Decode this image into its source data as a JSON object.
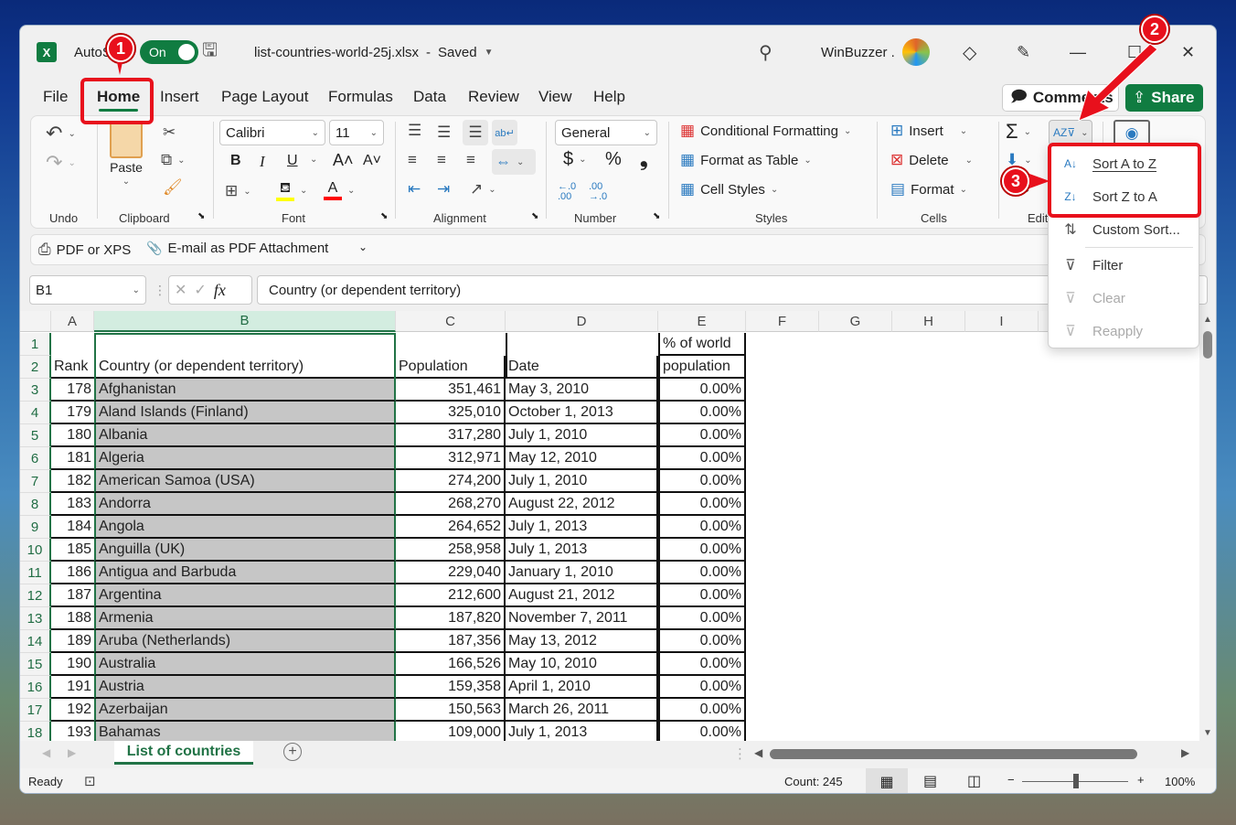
{
  "titlebar": {
    "app_icon": "excel-logo",
    "autosave_label": "AutoSave",
    "autosave_state": "On",
    "save_icon": "save-refresh-icon",
    "filename": "list-countries-world-25j.xlsx",
    "separator": "-",
    "save_status": "Saved",
    "search_icon": "search-icon",
    "account_name": "WinBuzzer .",
    "premium_icon": "diamond-icon",
    "pen_icon": "pen-sparkle-icon",
    "minimize": "—",
    "maximize": "☐",
    "close": "✕"
  },
  "menu_tabs": [
    "File",
    "Home",
    "Insert",
    "Page Layout",
    "Formulas",
    "Data",
    "Review",
    "View",
    "Help"
  ],
  "active_tab": "Home",
  "header_buttons": {
    "comments": "Comments",
    "share": "Share"
  },
  "ribbon": {
    "undo_group": {
      "label": "Undo"
    },
    "clipboard": {
      "label": "Clipboard",
      "paste": "Paste"
    },
    "font": {
      "label": "Font",
      "name": "Calibri",
      "size": "11",
      "bold": "B",
      "italic": "I",
      "underline": "U",
      "grow": "A˄",
      "shrink": "A˅",
      "fill_color": "#ffff00",
      "font_color": "#ff0000"
    },
    "alignment": {
      "label": "Alignment"
    },
    "number": {
      "label": "Number",
      "format": "General",
      "currency": "$",
      "percent": "%",
      "comma": "❟",
      "inc_decimal": "←.0 .00",
      "dec_decimal": ".00 →.0"
    },
    "styles": {
      "label": "Styles",
      "conditional_formatting": "Conditional Formatting",
      "format_as_table": "Format as Table",
      "cell_styles": "Cell Styles"
    },
    "cells": {
      "label": "Cells",
      "insert": "Insert",
      "delete": "Delete",
      "format": "Format"
    },
    "editing": {
      "label": "Editing",
      "label_visible": "Edit",
      "autosum": "Σ"
    }
  },
  "quick_access": {
    "pdf_xps": "PDF or XPS",
    "email_pdf": "E-mail as PDF Attachment"
  },
  "formula_bar": {
    "name_box": "B1",
    "cancel": "✕",
    "enter": "✓",
    "fx": "fx",
    "content": "Country (or dependent territory)"
  },
  "sheet": {
    "columns": [
      "A",
      "B",
      "C",
      "D",
      "E",
      "F",
      "G",
      "H",
      "I"
    ],
    "selected_column": "B",
    "header_row1": {
      "E": "% of world"
    },
    "header_row2": {
      "A": "Rank",
      "B": "Country (or dependent territory)",
      "C": "Population",
      "D": "Date",
      "E": "population"
    },
    "rows": [
      {
        "n": "3",
        "rank": "178",
        "country": "Afghanistan",
        "population": "351,461",
        "date": "May 3, 2010",
        "pct": "0.00%"
      },
      {
        "n": "4",
        "rank": "179",
        "country": "Aland Islands (Finland)",
        "population": "325,010",
        "date": "October 1, 2013",
        "pct": "0.00%"
      },
      {
        "n": "5",
        "rank": "180",
        "country": "Albania",
        "population": "317,280",
        "date": "July 1, 2010",
        "pct": "0.00%"
      },
      {
        "n": "6",
        "rank": "181",
        "country": "Algeria",
        "population": "312,971",
        "date": "May 12, 2010",
        "pct": "0.00%"
      },
      {
        "n": "7",
        "rank": "182",
        "country": "American Samoa (USA)",
        "population": "274,200",
        "date": "July 1, 2010",
        "pct": "0.00%"
      },
      {
        "n": "8",
        "rank": "183",
        "country": "Andorra",
        "population": "268,270",
        "date": "August 22, 2012",
        "pct": "0.00%"
      },
      {
        "n": "9",
        "rank": "184",
        "country": "Angola",
        "population": "264,652",
        "date": "July 1, 2013",
        "pct": "0.00%"
      },
      {
        "n": "10",
        "rank": "185",
        "country": "Anguilla (UK)",
        "population": "258,958",
        "date": "July 1, 2013",
        "pct": "0.00%"
      },
      {
        "n": "11",
        "rank": "186",
        "country": "Antigua and Barbuda",
        "population": "229,040",
        "date": "January 1, 2010",
        "pct": "0.00%"
      },
      {
        "n": "12",
        "rank": "187",
        "country": "Argentina",
        "population": "212,600",
        "date": "August 21, 2012",
        "pct": "0.00%"
      },
      {
        "n": "13",
        "rank": "188",
        "country": "Armenia",
        "population": "187,820",
        "date": "November 7, 2011",
        "pct": "0.00%"
      },
      {
        "n": "14",
        "rank": "189",
        "country": "Aruba (Netherlands)",
        "population": "187,356",
        "date": "May 13, 2012",
        "pct": "0.00%"
      },
      {
        "n": "15",
        "rank": "190",
        "country": "Australia",
        "population": "166,526",
        "date": "May 10, 2010",
        "pct": "0.00%"
      },
      {
        "n": "16",
        "rank": "191",
        "country": "Austria",
        "population": "159,358",
        "date": "April 1, 2010",
        "pct": "0.00%"
      },
      {
        "n": "17",
        "rank": "192",
        "country": "Azerbaijan",
        "population": "150,563",
        "date": "March 26, 2011",
        "pct": "0.00%"
      },
      {
        "n": "18",
        "rank": "193",
        "country": "Bahamas",
        "population": "109,000",
        "date": "July 1, 2013",
        "pct": "0.00%"
      }
    ],
    "tab_name": "List of countries"
  },
  "sort_filter_menu": {
    "items": [
      {
        "label": "Sort A to Z",
        "icon": "sort-a-z-icon",
        "enabled": true
      },
      {
        "label": "Sort Z to A",
        "icon": "sort-z-a-icon",
        "enabled": true
      },
      {
        "label": "Custom Sort...",
        "icon": "custom-sort-icon",
        "enabled": true
      },
      {
        "label": "Filter",
        "icon": "filter-icon",
        "enabled": true
      },
      {
        "label": "Clear",
        "icon": "clear-filter-icon",
        "enabled": false
      },
      {
        "label": "Reapply",
        "icon": "reapply-filter-icon",
        "enabled": false
      }
    ]
  },
  "status_bar": {
    "mode": "Ready",
    "count": "Count: 245",
    "zoom": "100%",
    "zoom_minus": "−",
    "zoom_plus": "+"
  },
  "annotations": {
    "step1": "1",
    "step2": "2",
    "step3": "3",
    "color": "#e8101c"
  }
}
